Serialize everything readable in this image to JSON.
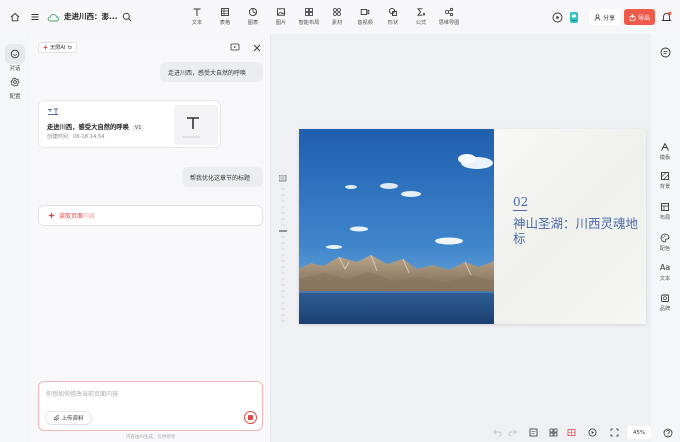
{
  "app": {
    "doc_title": "走进川西：澎..."
  },
  "toolbar": {
    "tools": [
      {
        "label": "文本",
        "icon": "text-icon"
      },
      {
        "label": "表格",
        "icon": "table-icon"
      },
      {
        "label": "图表",
        "icon": "chart-icon"
      },
      {
        "label": "图片",
        "icon": "image-icon"
      },
      {
        "label": "智能布局",
        "icon": "smart-layout-icon"
      },
      {
        "label": "素材",
        "icon": "material-icon"
      },
      {
        "label": "音视频",
        "icon": "media-icon"
      },
      {
        "label": "形状",
        "icon": "shape-icon"
      },
      {
        "label": "公式",
        "icon": "formula-icon"
      },
      {
        "label": "思维导图",
        "icon": "mindmap-icon"
      }
    ],
    "share_label": "分享",
    "export_label": "导出",
    "accent_color": "#f05a4a"
  },
  "left_nav": {
    "items": [
      {
        "label": "对话",
        "icon": "chat-icon",
        "active": true
      },
      {
        "label": "配置",
        "icon": "settings-icon",
        "active": false
      }
    ]
  },
  "chat": {
    "mode_tag": "无限AI",
    "messages": [
      {
        "role": "user",
        "text": "走进川西，感受大自然的呼唤"
      },
      {
        "role": "user",
        "text": "帮我优化这章节的标题"
      }
    ],
    "doc_card": {
      "title": "走进川西，感受大自然的呼唤",
      "version": "V1",
      "date": "创建时间：08-18 14:54"
    },
    "read_action": {
      "prefix": "读取页面",
      "suffix": "内容"
    },
    "input_placeholder": "你想如何修改当前页面内容",
    "upload_label": "上传资料",
    "disclaimer": "内容由AI生成，仅供参考"
  },
  "slide": {
    "number": "02",
    "title": "神山圣湖：川西灵魂地标",
    "title_color": "#4a6aa8"
  },
  "right_panel": {
    "items": [
      {
        "label": "模板",
        "icon": "template-icon"
      },
      {
        "label": "背景",
        "icon": "background-icon"
      },
      {
        "label": "布局",
        "icon": "layout-icon"
      },
      {
        "label": "配色",
        "icon": "palette-icon"
      },
      {
        "label": "文本",
        "icon": "text-style-icon"
      },
      {
        "label": "品牌",
        "icon": "brand-icon"
      }
    ]
  },
  "bottom": {
    "zoom": "45%"
  }
}
